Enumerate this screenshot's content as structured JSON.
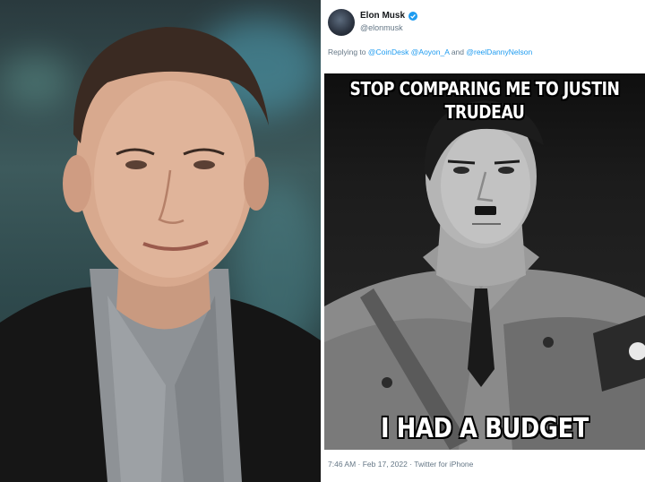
{
  "tweet": {
    "display_name": "Elon Musk",
    "handle": "@elonmusk",
    "reply_prefix": "Replying to",
    "mentions": [
      "@CoinDesk",
      "@Aoyon_A",
      "@reelDannyNelson"
    ],
    "reply_and": "and",
    "meme_top_line1": "STOP COMPARING ME TO JUSTIN",
    "meme_top_line2": "TRUDEAU",
    "meme_bottom": "I HAD A BUDGET",
    "footer": "7:46 AM · Feb 17, 2022 · Twitter for iPhone"
  },
  "icons": {
    "verified": "verified-badge-icon"
  },
  "colors": {
    "link": "#1d9bf0",
    "muted": "#657786",
    "name": "#14171a"
  }
}
